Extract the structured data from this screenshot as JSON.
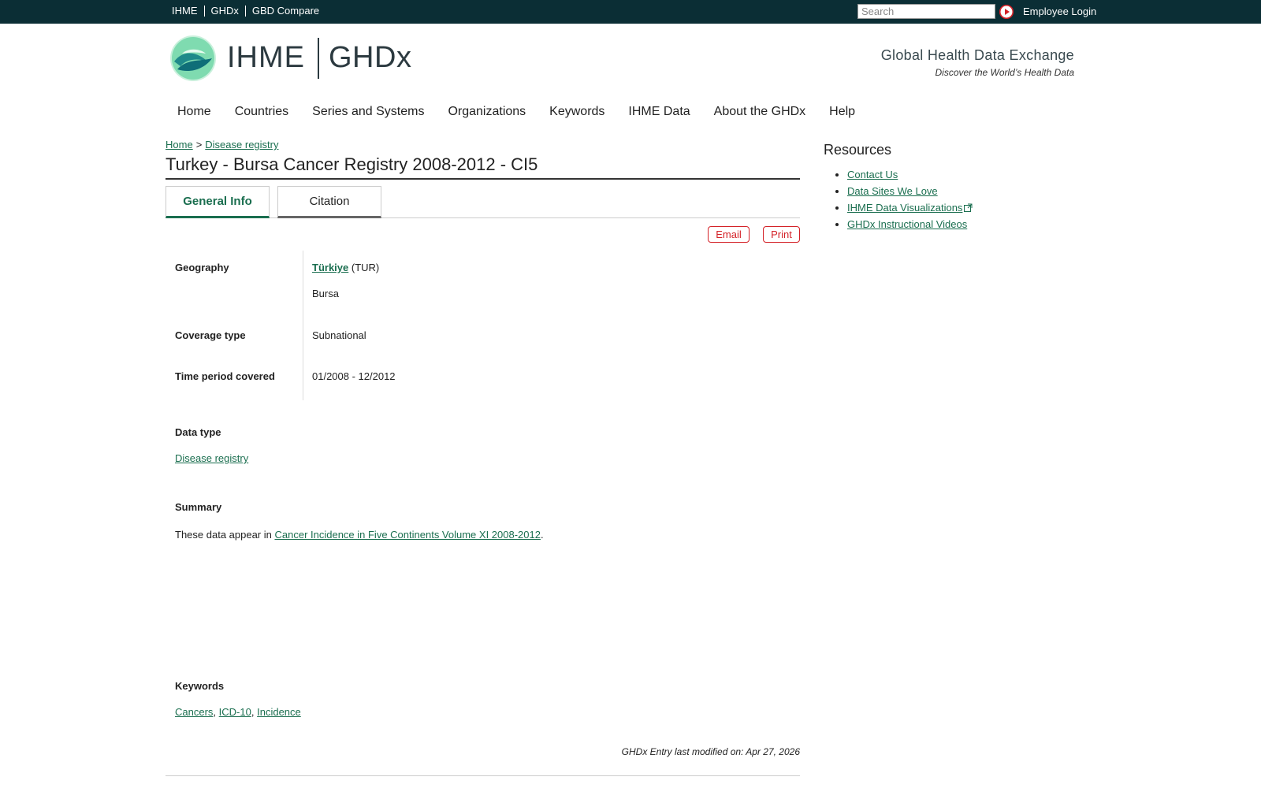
{
  "topbar": {
    "links": [
      "IHME",
      "GHDx",
      "GBD Compare"
    ],
    "search_placeholder": "Search",
    "employee_login": "Employee Login"
  },
  "header": {
    "logo_ihme": "IHME",
    "logo_ghdx": "GHDx",
    "site_title": "Global Health Data Exchange",
    "site_slogan": "Discover the World’s Health Data"
  },
  "nav": {
    "items": [
      "Home",
      "Countries",
      "Series and Systems",
      "Organizations",
      "Keywords",
      "IHME Data",
      "About the GHDx",
      "Help"
    ]
  },
  "breadcrumb": {
    "home": "Home",
    "sep": ">",
    "current": "Disease registry"
  },
  "page_title": "Turkey - Bursa Cancer Registry 2008-2012 - CI5",
  "tabs": {
    "general": "General Info",
    "citation": "Citation"
  },
  "actions": {
    "email": "Email",
    "print": "Print"
  },
  "info": {
    "geography_label": "Geography",
    "country": "Türkiye",
    "country_code": "(TUR)",
    "subnational": "Bursa",
    "coverage_label": "Coverage type",
    "coverage_value": "Subnational",
    "time_label": "Time period covered",
    "time_value": "01/2008 - 12/2012"
  },
  "data_type": {
    "label": "Data type",
    "value": "Disease registry"
  },
  "summary": {
    "label": "Summary",
    "prefix": "These data appear in ",
    "link": "Cancer Incidence in Five Continents Volume XI 2008-2012",
    "suffix": "."
  },
  "keywords": {
    "label": "Keywords",
    "items": [
      "Cancers",
      "ICD-10",
      "Incidence"
    ],
    "sep": ","
  },
  "modified": "GHDx Entry last modified on: Apr 27, 2026",
  "sidebar": {
    "title": "Resources",
    "items": [
      "Contact Us",
      "Data Sites We Love",
      "IHME Data Visualizations",
      "GHDx Instructional Videos"
    ]
  },
  "colors": {
    "topbar": "#0b2e35",
    "link": "#1a6e4f",
    "accent_red": "#d42127"
  }
}
